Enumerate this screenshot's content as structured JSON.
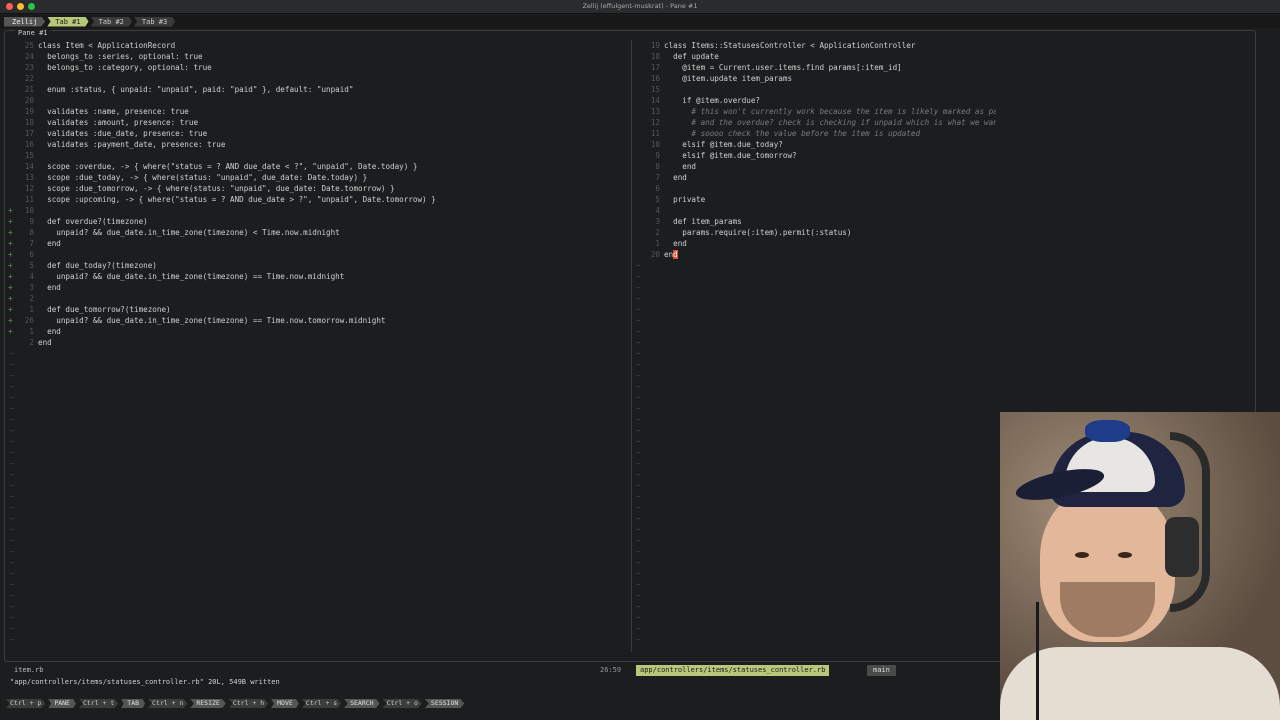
{
  "window": {
    "title": "Zellij (effulgent-muskrat) - Pane #1",
    "traffic_lights": [
      "#ff5f57",
      "#febc2e",
      "#28c840"
    ]
  },
  "tabs": {
    "session": "Zellij",
    "items": [
      {
        "label": "Tab #1",
        "active": true
      },
      {
        "label": "Tab #2",
        "active": false
      },
      {
        "label": "Tab #3",
        "active": false
      }
    ]
  },
  "pane_title": "Pane #1",
  "left_pane": {
    "file": "item.rb",
    "lines": [
      {
        "n": "25",
        "m": "",
        "t": "class Item < ApplicationRecord"
      },
      {
        "n": "24",
        "m": "",
        "t": "  belongs_to :series, optional: true"
      },
      {
        "n": "23",
        "m": "",
        "t": "  belongs_to :category, optional: true"
      },
      {
        "n": "22",
        "m": "",
        "t": ""
      },
      {
        "n": "21",
        "m": "",
        "t": "  enum :status, { unpaid: \"unpaid\", paid: \"paid\" }, default: \"unpaid\""
      },
      {
        "n": "20",
        "m": "",
        "t": ""
      },
      {
        "n": "19",
        "m": "",
        "t": "  validates :name, presence: true"
      },
      {
        "n": "18",
        "m": "",
        "t": "  validates :amount, presence: true"
      },
      {
        "n": "17",
        "m": "",
        "t": "  validates :due_date, presence: true"
      },
      {
        "n": "16",
        "m": "",
        "t": "  validates :payment_date, presence: true"
      },
      {
        "n": "15",
        "m": "",
        "t": ""
      },
      {
        "n": "14",
        "m": "",
        "t": "  scope :overdue, -> { where(\"status = ? AND due_date < ?\", \"unpaid\", Date.today) }"
      },
      {
        "n": "13",
        "m": "",
        "t": "  scope :due_today, -> { where(status: \"unpaid\", due_date: Date.today) }"
      },
      {
        "n": "12",
        "m": "",
        "t": "  scope :due_tomorrow, -> { where(status: \"unpaid\", due_date: Date.tomorrow) }"
      },
      {
        "n": "11",
        "m": "",
        "t": "  scope :upcoming, -> { where(\"status = ? AND due_date > ?\", \"unpaid\", Date.tomorrow) }"
      },
      {
        "n": "10",
        "m": "+",
        "t": ""
      },
      {
        "n": "9",
        "m": "+",
        "t": "  def overdue?(timezone)"
      },
      {
        "n": "8",
        "m": "+",
        "t": "    unpaid? && due_date.in_time_zone(timezone) < Time.now.midnight"
      },
      {
        "n": "7",
        "m": "+",
        "t": "  end"
      },
      {
        "n": "6",
        "m": "+",
        "t": ""
      },
      {
        "n": "5",
        "m": "+",
        "t": "  def due_today?(timezone)"
      },
      {
        "n": "4",
        "m": "+",
        "t": "    unpaid? && due_date.in_time_zone(timezone) == Time.now.midnight"
      },
      {
        "n": "3",
        "m": "+",
        "t": "  end"
      },
      {
        "n": "2",
        "m": "+",
        "t": ""
      },
      {
        "n": "1",
        "m": "+",
        "t": "  def due_tomorrow?(timezone)"
      },
      {
        "n": "26",
        "m": "+",
        "t": "    unpaid? && due_date.in_time_zone(timezone) == Time.now.tomorrow.midnight"
      },
      {
        "n": "1",
        "m": "+",
        "t": "  end"
      },
      {
        "n": "2",
        "m": "",
        "t": "end"
      }
    ]
  },
  "right_pane": {
    "file": "app/controllers/items/statuses_controller.rb",
    "position": "26:59",
    "branch": "main",
    "lines": [
      {
        "n": "19",
        "t": "class Items::StatusesController < ApplicationController"
      },
      {
        "n": "18",
        "t": "  def update"
      },
      {
        "n": "17",
        "t": "    @item = Current.user.items.find params[:item_id]"
      },
      {
        "n": "16",
        "t": "    @item.update item_params"
      },
      {
        "n": "15",
        "t": ""
      },
      {
        "n": "14",
        "t": "    if @item.overdue?"
      },
      {
        "n": "13",
        "t": "      # this won't currently work because the item is likely marked as paid at this point"
      },
      {
        "n": "12",
        "t": "      # and the overdue? check is checking if unpaid which is what we want"
      },
      {
        "n": "11",
        "t": "      # soooo check the value before the item is updated"
      },
      {
        "n": "10",
        "t": "    elsif @item.due_today?"
      },
      {
        "n": "9",
        "t": "    elsif @item.due_tomorrow?"
      },
      {
        "n": "8",
        "t": "    end"
      },
      {
        "n": "7",
        "t": "  end"
      },
      {
        "n": "6",
        "t": ""
      },
      {
        "n": "5",
        "t": "  private"
      },
      {
        "n": "4",
        "t": ""
      },
      {
        "n": "3",
        "t": "  def item_params"
      },
      {
        "n": "2",
        "t": "    params.require(:item).permit(:status)"
      },
      {
        "n": "1",
        "t": "  end"
      },
      {
        "n": "20",
        "t": "end"
      }
    ]
  },
  "message_line": "\"app/controllers/items/statuses_controller.rb\" 20L, 549B written",
  "keybar": [
    {
      "key": "Ctrl + p",
      "action": "PANE"
    },
    {
      "key": "Ctrl + t",
      "action": "TAB"
    },
    {
      "key": "Ctrl + n",
      "action": "RESIZE"
    },
    {
      "key": "Ctrl + h",
      "action": "MOVE"
    },
    {
      "key": "Ctrl + s",
      "action": "SEARCH"
    },
    {
      "key": "Ctrl + o",
      "action": "SESSION"
    }
  ]
}
